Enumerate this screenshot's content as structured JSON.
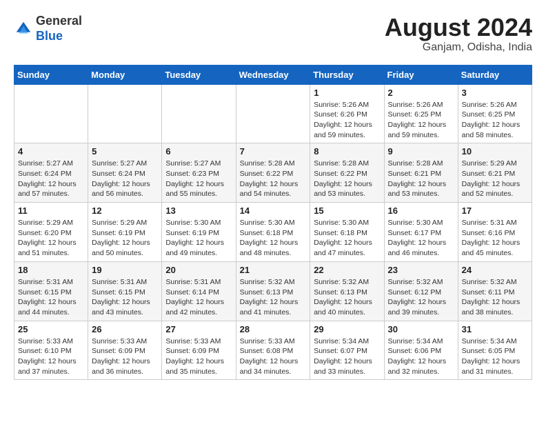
{
  "header": {
    "logo_general": "General",
    "logo_blue": "Blue",
    "month_year": "August 2024",
    "location": "Ganjam, Odisha, India"
  },
  "weekdays": [
    "Sunday",
    "Monday",
    "Tuesday",
    "Wednesday",
    "Thursday",
    "Friday",
    "Saturday"
  ],
  "weeks": [
    [
      {
        "day": "",
        "info": ""
      },
      {
        "day": "",
        "info": ""
      },
      {
        "day": "",
        "info": ""
      },
      {
        "day": "",
        "info": ""
      },
      {
        "day": "1",
        "info": "Sunrise: 5:26 AM\nSunset: 6:26 PM\nDaylight: 12 hours\nand 59 minutes."
      },
      {
        "day": "2",
        "info": "Sunrise: 5:26 AM\nSunset: 6:25 PM\nDaylight: 12 hours\nand 59 minutes."
      },
      {
        "day": "3",
        "info": "Sunrise: 5:26 AM\nSunset: 6:25 PM\nDaylight: 12 hours\nand 58 minutes."
      }
    ],
    [
      {
        "day": "4",
        "info": "Sunrise: 5:27 AM\nSunset: 6:24 PM\nDaylight: 12 hours\nand 57 minutes."
      },
      {
        "day": "5",
        "info": "Sunrise: 5:27 AM\nSunset: 6:24 PM\nDaylight: 12 hours\nand 56 minutes."
      },
      {
        "day": "6",
        "info": "Sunrise: 5:27 AM\nSunset: 6:23 PM\nDaylight: 12 hours\nand 55 minutes."
      },
      {
        "day": "7",
        "info": "Sunrise: 5:28 AM\nSunset: 6:22 PM\nDaylight: 12 hours\nand 54 minutes."
      },
      {
        "day": "8",
        "info": "Sunrise: 5:28 AM\nSunset: 6:22 PM\nDaylight: 12 hours\nand 53 minutes."
      },
      {
        "day": "9",
        "info": "Sunrise: 5:28 AM\nSunset: 6:21 PM\nDaylight: 12 hours\nand 53 minutes."
      },
      {
        "day": "10",
        "info": "Sunrise: 5:29 AM\nSunset: 6:21 PM\nDaylight: 12 hours\nand 52 minutes."
      }
    ],
    [
      {
        "day": "11",
        "info": "Sunrise: 5:29 AM\nSunset: 6:20 PM\nDaylight: 12 hours\nand 51 minutes."
      },
      {
        "day": "12",
        "info": "Sunrise: 5:29 AM\nSunset: 6:19 PM\nDaylight: 12 hours\nand 50 minutes."
      },
      {
        "day": "13",
        "info": "Sunrise: 5:30 AM\nSunset: 6:19 PM\nDaylight: 12 hours\nand 49 minutes."
      },
      {
        "day": "14",
        "info": "Sunrise: 5:30 AM\nSunset: 6:18 PM\nDaylight: 12 hours\nand 48 minutes."
      },
      {
        "day": "15",
        "info": "Sunrise: 5:30 AM\nSunset: 6:18 PM\nDaylight: 12 hours\nand 47 minutes."
      },
      {
        "day": "16",
        "info": "Sunrise: 5:30 AM\nSunset: 6:17 PM\nDaylight: 12 hours\nand 46 minutes."
      },
      {
        "day": "17",
        "info": "Sunrise: 5:31 AM\nSunset: 6:16 PM\nDaylight: 12 hours\nand 45 minutes."
      }
    ],
    [
      {
        "day": "18",
        "info": "Sunrise: 5:31 AM\nSunset: 6:15 PM\nDaylight: 12 hours\nand 44 minutes."
      },
      {
        "day": "19",
        "info": "Sunrise: 5:31 AM\nSunset: 6:15 PM\nDaylight: 12 hours\nand 43 minutes."
      },
      {
        "day": "20",
        "info": "Sunrise: 5:31 AM\nSunset: 6:14 PM\nDaylight: 12 hours\nand 42 minutes."
      },
      {
        "day": "21",
        "info": "Sunrise: 5:32 AM\nSunset: 6:13 PM\nDaylight: 12 hours\nand 41 minutes."
      },
      {
        "day": "22",
        "info": "Sunrise: 5:32 AM\nSunset: 6:13 PM\nDaylight: 12 hours\nand 40 minutes."
      },
      {
        "day": "23",
        "info": "Sunrise: 5:32 AM\nSunset: 6:12 PM\nDaylight: 12 hours\nand 39 minutes."
      },
      {
        "day": "24",
        "info": "Sunrise: 5:32 AM\nSunset: 6:11 PM\nDaylight: 12 hours\nand 38 minutes."
      }
    ],
    [
      {
        "day": "25",
        "info": "Sunrise: 5:33 AM\nSunset: 6:10 PM\nDaylight: 12 hours\nand 37 minutes."
      },
      {
        "day": "26",
        "info": "Sunrise: 5:33 AM\nSunset: 6:09 PM\nDaylight: 12 hours\nand 36 minutes."
      },
      {
        "day": "27",
        "info": "Sunrise: 5:33 AM\nSunset: 6:09 PM\nDaylight: 12 hours\nand 35 minutes."
      },
      {
        "day": "28",
        "info": "Sunrise: 5:33 AM\nSunset: 6:08 PM\nDaylight: 12 hours\nand 34 minutes."
      },
      {
        "day": "29",
        "info": "Sunrise: 5:34 AM\nSunset: 6:07 PM\nDaylight: 12 hours\nand 33 minutes."
      },
      {
        "day": "30",
        "info": "Sunrise: 5:34 AM\nSunset: 6:06 PM\nDaylight: 12 hours\nand 32 minutes."
      },
      {
        "day": "31",
        "info": "Sunrise: 5:34 AM\nSunset: 6:05 PM\nDaylight: 12 hours\nand 31 minutes."
      }
    ]
  ]
}
